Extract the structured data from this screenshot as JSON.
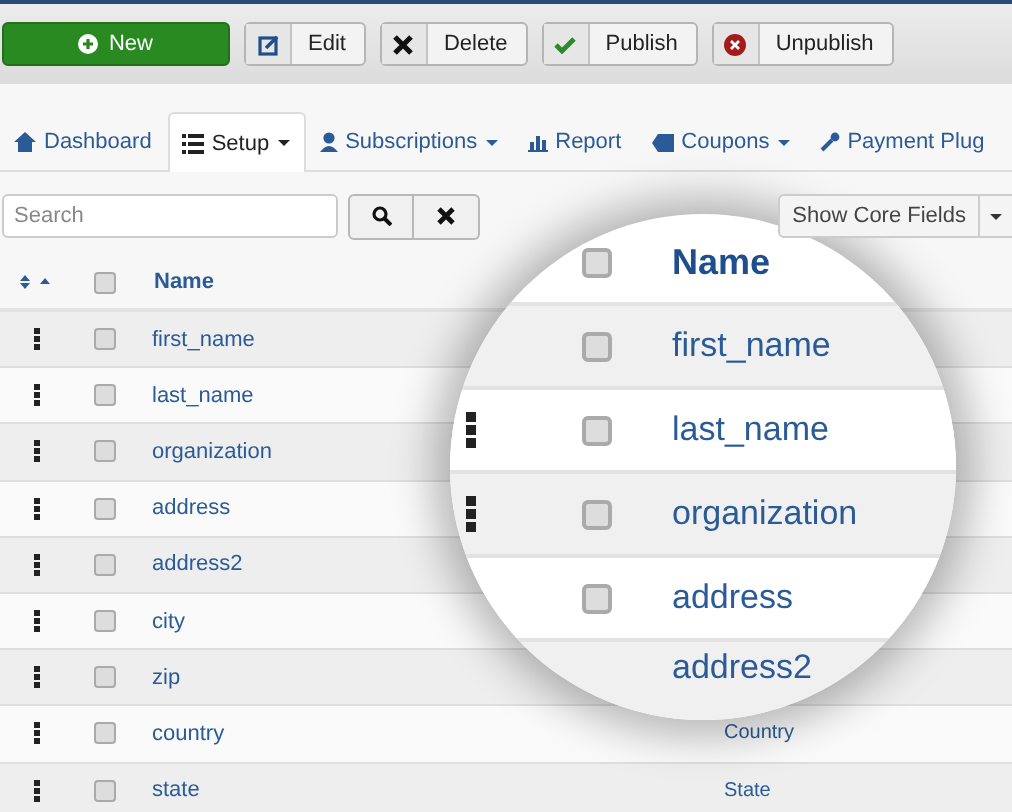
{
  "toolbar": [
    {
      "kind": "new",
      "label": "New"
    },
    {
      "kind": "edit",
      "label": "Edit"
    },
    {
      "kind": "delete",
      "label": "Delete"
    },
    {
      "kind": "publish",
      "label": "Publish"
    },
    {
      "kind": "unpublish",
      "label": "Unpublish"
    }
  ],
  "tabs": [
    {
      "kind": "home",
      "label": "Dashboard",
      "selected": false,
      "dropdown": false
    },
    {
      "kind": "list",
      "label": "Setup",
      "selected": true,
      "dropdown": true
    },
    {
      "kind": "user",
      "label": "Subscriptions",
      "selected": false,
      "dropdown": true
    },
    {
      "kind": "chart",
      "label": "Report",
      "selected": false,
      "dropdown": false
    },
    {
      "kind": "tag",
      "label": "Coupons",
      "selected": false,
      "dropdown": true
    },
    {
      "kind": "wrench",
      "label": "Payment Plug",
      "selected": false,
      "dropdown": false
    }
  ],
  "search": {
    "placeholder": "Search"
  },
  "filter": {
    "value": "Show Core Fields"
  },
  "table": {
    "columns": [
      "Name"
    ],
    "all_checked": false,
    "rows": [
      {
        "name": "first_name",
        "checked": false
      },
      {
        "name": "last_name",
        "checked": false
      },
      {
        "name": "organization",
        "checked": false
      },
      {
        "name": "address",
        "checked": false
      },
      {
        "name": "address2",
        "checked": false
      },
      {
        "name": "city",
        "checked": false
      },
      {
        "name": "zip",
        "checked": false
      },
      {
        "name": "country",
        "column_3": "Country",
        "checked": false
      },
      {
        "name": "state",
        "column_3": "State",
        "checked": false
      }
    ]
  },
  "magnifier": {
    "header": "Name",
    "all_checked": false,
    "rows": [
      {
        "name": "first_name",
        "handle": false,
        "checked": false
      },
      {
        "name": "last_name",
        "handle": true,
        "checked": false
      },
      {
        "name": "organization",
        "handle": true,
        "checked": false
      },
      {
        "name": "address",
        "handle": false,
        "checked": false
      },
      {
        "name": "address2",
        "handle": false
      }
    ]
  }
}
